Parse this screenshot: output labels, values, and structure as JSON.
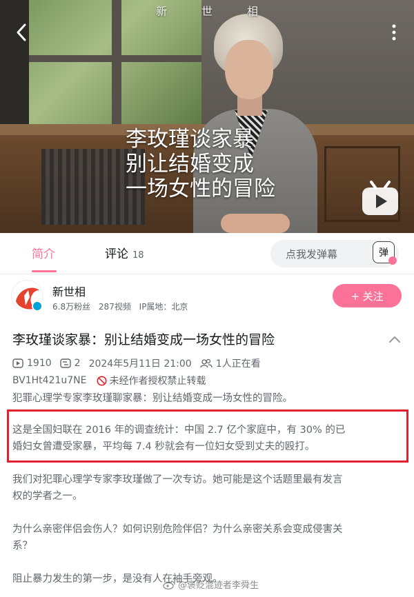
{
  "video": {
    "channel_overlay": "新世相",
    "subtitle_lines": [
      "李玫瑾谈家暴",
      "别让结婚变成",
      "一场女性的冒险"
    ]
  },
  "tabs": {
    "intro": "简介",
    "comments": "评论",
    "comments_count": "18",
    "danmaku_placeholder": "点我发弹幕",
    "danmaku_button": "弹"
  },
  "uploader": {
    "name": "新世相",
    "followers": "6.8万粉丝",
    "videos": "287视频",
    "ip": "IP属地：北京",
    "follow_label": "+ 关注"
  },
  "info": {
    "title": "李玫瑾谈家暴：别让结婚变成一场女性的冒险",
    "plays": "1910",
    "danmaku_count": "2",
    "datetime": "2024年5月11日 21:00",
    "watching": "1人正在看",
    "bvid": "BV1Ht421u7NE",
    "no_repost": "未经作者授权禁止转载"
  },
  "description": {
    "line1": "犯罪心理学专家李玫瑾聊家暴：别让结婚变成一场女性的冒险。",
    "line2a": "这是全国妇联在 2016 年的调查统计：中国 2.7 亿个家庭中，有 30% 的已",
    "line2b": "婚妇女曾遭受家暴，平均每 7.4 秒就会有一位妇女受到丈夫的殴打。",
    "line3a": "我们对犯罪心理学专家李玫瑾做了一次专访。她可能是这个话题里最有发言",
    "line3b": "权的学者之一。",
    "line4a": "为什么亲密伴侣会伤人？如何识别危险伴侣？为什么亲密关系会变成侵害关",
    "line4b": "系？",
    "line5": "阻止暴力发生的第一步，是没有人在袖手旁观。"
  },
  "watermark": "@褒贬混迹者李舜生",
  "colors": {
    "accent_pink": "#fb7299",
    "highlight_red": "#e0202a",
    "text_primary": "#18191c",
    "text_secondary": "#61666d"
  }
}
